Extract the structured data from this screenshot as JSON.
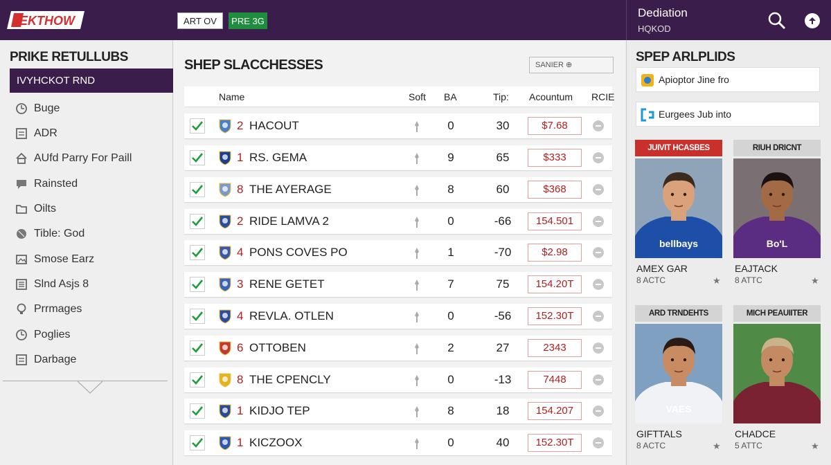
{
  "header": {
    "logo_text": "EKTHOW",
    "buttons": [
      "ART OV",
      "PRE 3G"
    ],
    "right_title": "Dediation",
    "right_subtitle": "HQKOD"
  },
  "sidebar": {
    "title": "PRIKE RETULLUBS",
    "active_item": "IVYHCKOT RND",
    "items": [
      {
        "label": "Buge",
        "icon": "clock-icon"
      },
      {
        "label": "ADR",
        "icon": "document-icon"
      },
      {
        "label": "AUfd Parry For Paill",
        "icon": "home-icon"
      },
      {
        "label": "Rainsted",
        "icon": "speech-icon"
      },
      {
        "label": "Oilts",
        "icon": "folder-icon"
      },
      {
        "label": "Tible: God",
        "icon": "ball-icon"
      },
      {
        "label": "Smose Earz",
        "icon": "image-icon"
      },
      {
        "label": "Slnd Asjs 8",
        "icon": "list-icon"
      },
      {
        "label": "Prrmages",
        "icon": "bulb-icon"
      },
      {
        "label": "Poglies",
        "icon": "clock-icon"
      },
      {
        "label": "Darbage",
        "icon": "document-icon"
      }
    ]
  },
  "main": {
    "title": "SHEP SLACCHESSES",
    "search_placeholder": "SANIER ⊕",
    "columns": [
      "Name",
      "Soft",
      "BA",
      "Tip:",
      "Acountum",
      "RCIE"
    ],
    "rows": [
      {
        "rank": "2",
        "name": "HACOUT",
        "ba": "0",
        "tip": "30",
        "amount": "$7.68",
        "crest": "#4a7fc1"
      },
      {
        "rank": "1",
        "name": "RS. GEMA",
        "ba": "9",
        "tip": "65",
        "amount": "$333",
        "crest": "#1b3f8a"
      },
      {
        "rank": "8",
        "name": "THE AYERAGE",
        "ba": "8",
        "tip": "60",
        "amount": "$368",
        "crest": "#7a9ac8"
      },
      {
        "rank": "2",
        "name": "RIDE LAMVA 2",
        "ba": "0",
        "tip": "-66",
        "amount": "154.501",
        "crest": "#2a4f9a"
      },
      {
        "rank": "4",
        "name": "PONS COVES PO",
        "ba": "1",
        "tip": "-70",
        "amount": "$2.98",
        "crest": "#3b57a8"
      },
      {
        "rank": "3",
        "name": "RENE GETET",
        "ba": "7",
        "tip": "75",
        "amount": "154.20T",
        "crest": "#3a63b5"
      },
      {
        "rank": "4",
        "name": "REVLA. OTLEN",
        "ba": "0",
        "tip": "-56",
        "amount": "152.30T",
        "crest": "#2c4d9c"
      },
      {
        "rank": "6",
        "name": "OTTOBEN",
        "ba": "2",
        "tip": "27",
        "amount": "2343",
        "crest": "#c23a2c"
      },
      {
        "rank": "8",
        "name": "THE CPENCLY",
        "ba": "0",
        "tip": "-13",
        "amount": "7448",
        "crest": "#e0b520"
      },
      {
        "rank": "1",
        "name": "KIDJO TEP",
        "ba": "8",
        "tip": "18",
        "amount": "154.207",
        "crest": "#2a4b92"
      },
      {
        "rank": "1",
        "name": "KICZOOX",
        "ba": "0",
        "tip": "40",
        "amount": "152.30T",
        "crest": "#2d58b0"
      }
    ]
  },
  "right_panel": {
    "title": "SPEP ARLPLIDS",
    "links": [
      {
        "label": "Apioptor Jine fro",
        "icon": "app-icon"
      },
      {
        "label": "Eurgees Jub into",
        "icon": "bracket-icon"
      }
    ],
    "cards": [
      {
        "header": "JUIVIT HCASBES",
        "header_bg": "#c8302c",
        "header_color": "#ffffff",
        "name": "AMEX GAR",
        "meta": "8 ACTC",
        "shirt": "#1d4fa8",
        "skin": "#d9a27a",
        "hair": "#3b2a1e",
        "bg": "#8fa4b8",
        "sponsor": "bellbays"
      },
      {
        "header": "RIUH DRICNT",
        "header_bg": "#d4d4d4",
        "header_color": "#222222",
        "name": "EAJTACK",
        "meta": "8 ATTC",
        "shirt": "#5a2d82",
        "skin": "#a26a45",
        "hair": "#1a1210",
        "bg": "#7a6f72",
        "sponsor": "Bo'L"
      },
      {
        "header": "ARD TRNDEHTS",
        "header_bg": "#d4d4d4",
        "header_color": "#222222",
        "name": "GIFTTALS",
        "meta": "8 ACTC",
        "shirt": "#f0f2f6",
        "skin": "#c98b62",
        "hair": "#2a1c14",
        "bg": "#7fa0c0",
        "sponsor": "VAES"
      },
      {
        "header": "MICH PEAUIITER",
        "header_bg": "#d4d4d4",
        "header_color": "#222222",
        "name": "CHADCE",
        "meta": "5 ATTC",
        "shirt": "#7a2232",
        "skin": "#c48a62",
        "hair": "#c9b48a",
        "bg": "#4f8a46",
        "sponsor": ""
      }
    ]
  },
  "colors": {
    "brand": "#3a1d4a",
    "accent_red": "#b02020",
    "check_green": "#1e9e3a"
  }
}
